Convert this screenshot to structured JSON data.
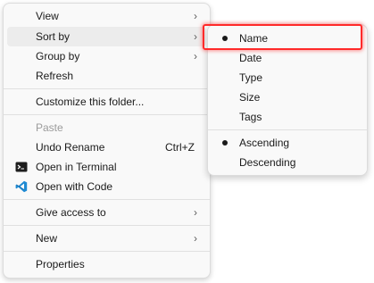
{
  "menu": {
    "items": [
      {
        "label": "View",
        "has_submenu": true
      },
      {
        "label": "Sort by",
        "has_submenu": true,
        "state": "hovered"
      },
      {
        "label": "Group by",
        "has_submenu": true
      },
      {
        "label": "Refresh"
      },
      {
        "label": "Customize this folder..."
      },
      {
        "label": "Paste",
        "state": "disabled"
      },
      {
        "label": "Undo Rename",
        "shortcut": "Ctrl+Z"
      },
      {
        "label": "Open in Terminal",
        "icon": "terminal-icon"
      },
      {
        "label": "Open with Code",
        "icon": "vscode-icon"
      },
      {
        "label": "Give access to",
        "has_submenu": true
      },
      {
        "label": "New",
        "has_submenu": true
      },
      {
        "label": "Properties"
      }
    ],
    "arrow_glyph": "›"
  },
  "submenu": {
    "items": [
      {
        "label": "Name",
        "selected": true
      },
      {
        "label": "Date"
      },
      {
        "label": "Type"
      },
      {
        "label": "Size"
      },
      {
        "label": "Tags"
      },
      {
        "label": "Ascending",
        "selected": true
      },
      {
        "label": "Descending"
      }
    ]
  },
  "colors": {
    "menu_background": "#f9f9f9",
    "hover_background": "#ececec",
    "highlight_border": "#ff2a2a",
    "terminal_icon": "#1e1e1e",
    "vscode_icon": "#1f8ad2",
    "disabled_text": "#9b9b9b"
  }
}
